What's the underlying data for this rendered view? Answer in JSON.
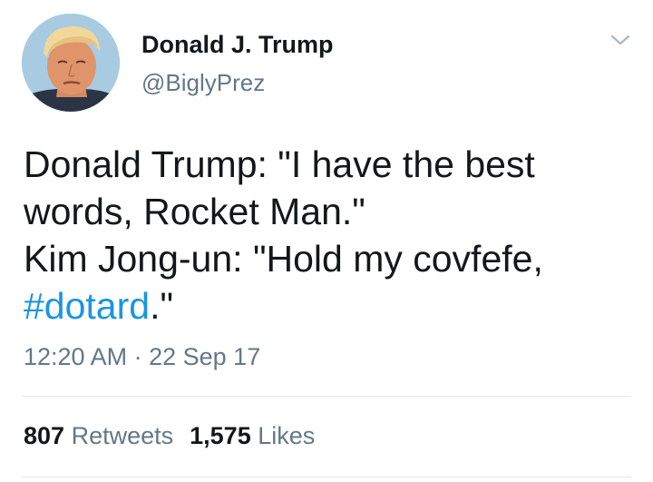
{
  "user": {
    "name": "Donald J. Trump",
    "handle": "@BiglyPrez"
  },
  "tweet": {
    "lines": [
      "Donald Trump: \"I have the best",
      "words, Rocket Man.\"",
      "Kim Jong-un: \"Hold my covfefe,"
    ],
    "hashtag": "#dotard",
    "hashtag_suffix": ".\""
  },
  "meta": {
    "time": "12:20 AM",
    "separator": "·",
    "date": "22 Sep 17"
  },
  "stats": {
    "retweets_count": "807",
    "retweets_label": "Retweets",
    "likes_count": "1,575",
    "likes_label": "Likes"
  },
  "icons": {
    "menu": "chevron-down-icon"
  },
  "colors": {
    "text": "#14171a",
    "secondary": "#657786",
    "link": "#1b95e0",
    "divider": "#e1e8ed"
  }
}
